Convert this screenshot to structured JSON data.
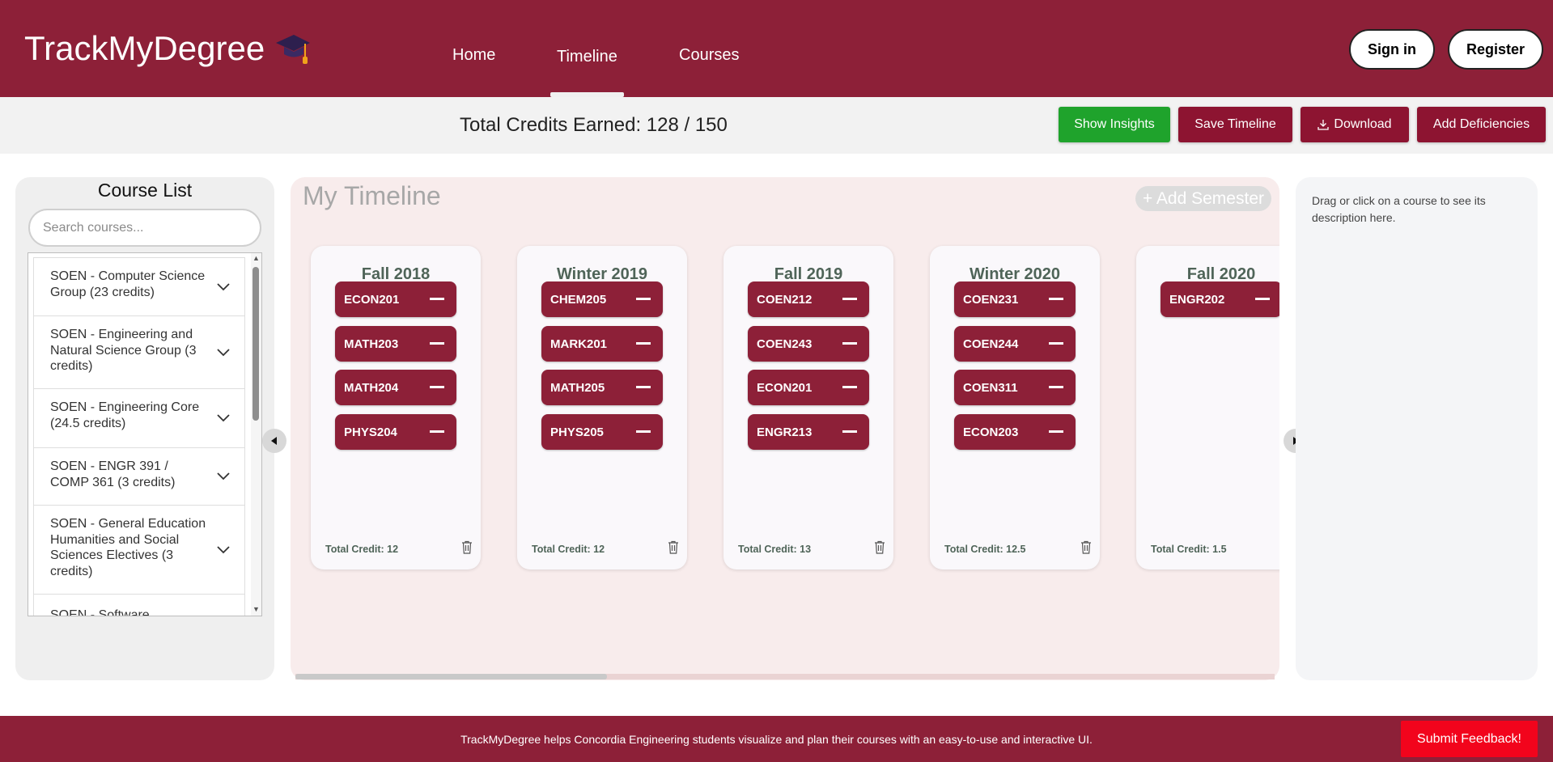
{
  "brand": {
    "title": "TrackMyDegree",
    "icon": "graduation-cap-icon"
  },
  "nav": {
    "home": "Home",
    "timeline": "Timeline",
    "courses": "Courses",
    "active": "Timeline"
  },
  "auth": {
    "sign_in": "Sign in",
    "register": "Register"
  },
  "toolbar": {
    "credits_label": "Total Credits Earned: 128 / 150",
    "show_insights": "Show Insights",
    "save_timeline": "Save Timeline",
    "download": "Download",
    "add_deficiencies": "Add Deficiencies"
  },
  "course_list": {
    "title": "Course List",
    "search_placeholder": "Search courses...",
    "groups": [
      "SOEN - Computer Science Group (23 credits)",
      "SOEN - Engineering and Natural Science Group (3 credits)",
      "SOEN - Engineering Core (24.5 credits)",
      "SOEN - ENGR 391 / COMP 361 (3 credits)",
      "SOEN - General Education Humanities and Social Sciences Electives (3 credits)",
      "SOEN - Software"
    ]
  },
  "timeline": {
    "title": "My Timeline",
    "add_semester": "+ Add Semester",
    "semesters": [
      {
        "name": "Fall 2018",
        "courses": [
          "ECON201",
          "MATH203",
          "MATH204",
          "PHYS204"
        ],
        "credit": "Total Credit: 12"
      },
      {
        "name": "Winter 2019",
        "courses": [
          "CHEM205",
          "MARK201",
          "MATH205",
          "PHYS205"
        ],
        "credit": "Total Credit: 12"
      },
      {
        "name": "Fall 2019",
        "courses": [
          "COEN212",
          "COEN243",
          "ECON201",
          "ENGR213"
        ],
        "credit": "Total Credit: 13"
      },
      {
        "name": "Winter 2020",
        "courses": [
          "COEN231",
          "COEN244",
          "COEN311",
          "ECON203"
        ],
        "credit": "Total Credit: 12.5"
      },
      {
        "name": "Fall 2020",
        "courses": [
          "ENGR202"
        ],
        "credit": "Total Credit: 1.5"
      }
    ]
  },
  "description": {
    "placeholder": "Drag or click on a course to see its description here."
  },
  "footer": {
    "text": "TrackMyDegree helps Concordia Engineering students visualize and plan their courses with an easy-to-use and interactive UI.",
    "feedback": "Submit Feedback!"
  },
  "colors": {
    "brand": "#8d2038",
    "insights": "#1fa32c",
    "action": "#8d1431",
    "feedback": "#f2041c"
  }
}
